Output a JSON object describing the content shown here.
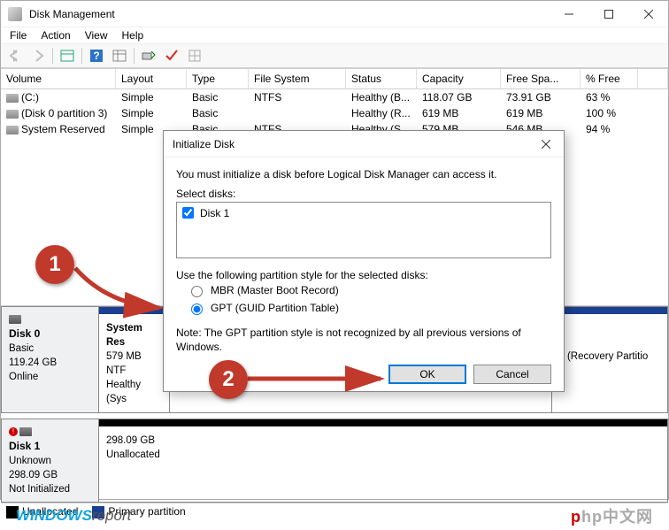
{
  "window": {
    "title": "Disk Management"
  },
  "menu": {
    "file": "File",
    "action": "Action",
    "view": "View",
    "help": "Help"
  },
  "columns": [
    "Volume",
    "Layout",
    "Type",
    "File System",
    "Status",
    "Capacity",
    "Free Spa...",
    "% Free"
  ],
  "volumes": [
    {
      "name": "(C:)",
      "layout": "Simple",
      "type": "Basic",
      "fs": "NTFS",
      "status": "Healthy (B...",
      "capacity": "118.07 GB",
      "free": "73.91 GB",
      "pct": "63 %"
    },
    {
      "name": "(Disk 0 partition 3)",
      "layout": "Simple",
      "type": "Basic",
      "fs": "",
      "status": "Healthy (R...",
      "capacity": "619 MB",
      "free": "619 MB",
      "pct": "100 %"
    },
    {
      "name": "System Reserved",
      "layout": "Simple",
      "type": "Basic",
      "fs": "NTFS",
      "status": "Healthy (S...",
      "capacity": "579 MB",
      "free": "546 MB",
      "pct": "94 %"
    }
  ],
  "disk0": {
    "label": "Disk 0",
    "kind": "Basic",
    "size": "119.24 GB",
    "state": "Online",
    "part1": {
      "title": "System Res",
      "line2": "579 MB NTF",
      "line3": "Healthy (Sys"
    },
    "part4": {
      "line": "y (Recovery Partitio"
    }
  },
  "disk1": {
    "label": "Disk 1",
    "kind": "Unknown",
    "size": "298.09 GB",
    "state": "Not Initialized",
    "unalloc": {
      "size": "298.09 GB",
      "label": "Unallocated"
    }
  },
  "legend": {
    "unallocated": "Unallocated",
    "primary": "Primary partition"
  },
  "dialog": {
    "title": "Initialize Disk",
    "intro": "You must initialize a disk before Logical Disk Manager can access it.",
    "select_label": "Select disks:",
    "disk_checkbox": "Disk 1",
    "style_label": "Use the following partition style for the selected disks:",
    "radio_mbr": "MBR (Master Boot Record)",
    "radio_gpt": "GPT (GUID Partition Table)",
    "note": "Note: The GPT partition style is not recognized by all previous versions of Windows.",
    "ok": "OK",
    "cancel": "Cancel"
  },
  "annotation": {
    "one": "1",
    "two": "2"
  },
  "branding": {
    "left_w": "WINDOWS",
    "left_r": "report",
    "right": "php中文网"
  }
}
